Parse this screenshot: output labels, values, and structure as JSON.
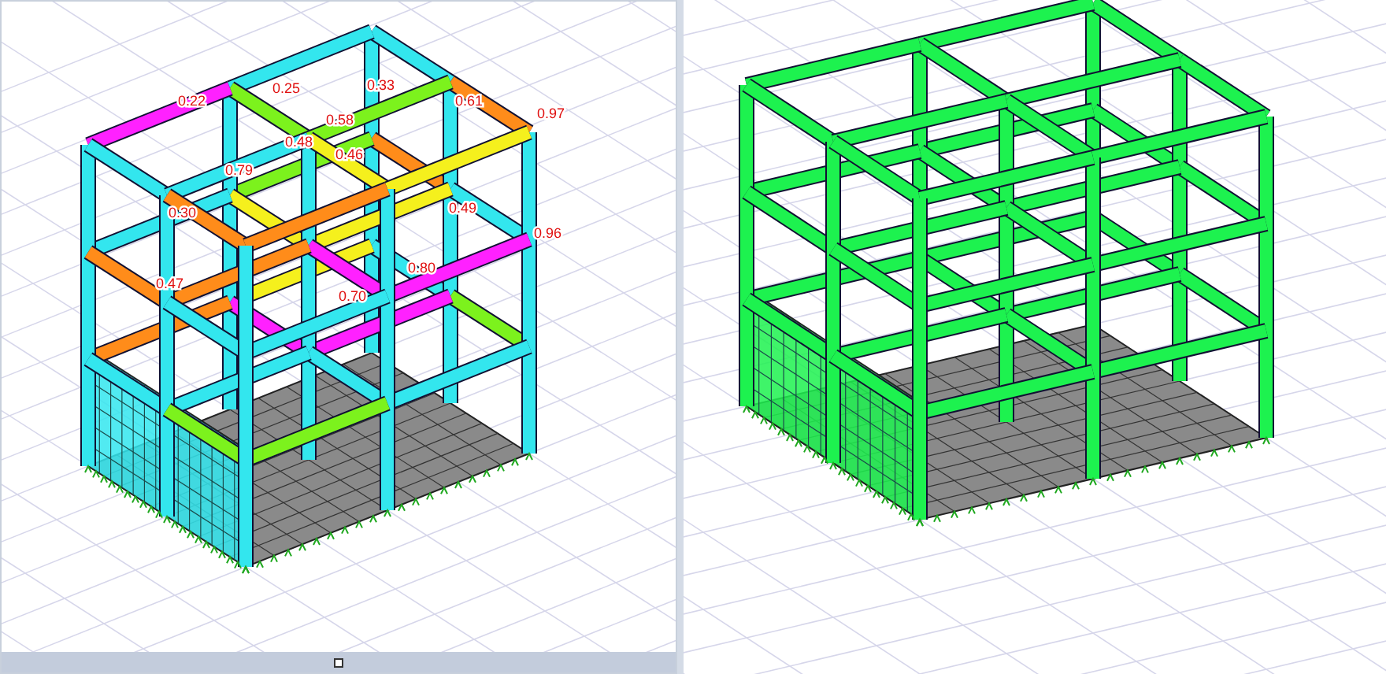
{
  "views": [
    {
      "kind": "ratios",
      "ratio_labels": [
        "0.22",
        "0.25",
        "0.33",
        "0.61",
        "0.97",
        "0.30",
        "0.49",
        "0.96",
        "0.46",
        "0.58",
        "0.79",
        "0.70",
        "0.80",
        "0.47",
        "0.48"
      ]
    },
    {
      "kind": "design"
    }
  ]
}
